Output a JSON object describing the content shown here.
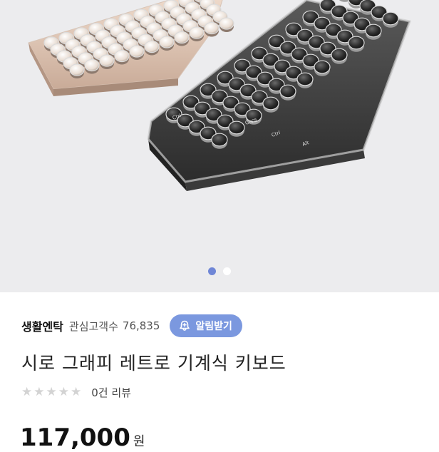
{
  "gallery": {
    "image_alt": "retro typewriter-style mechanical keyboards, pink-gold and black",
    "key_legends": [
      "Alt",
      "Caps",
      "Ctrl",
      "Ctrl"
    ],
    "slide_count": 2,
    "active_slide": 1
  },
  "seller": {
    "name": "생활엔탁",
    "follower_label": "관심고객수",
    "follower_count": "76,835",
    "notify_label": "알림받기",
    "notify_icon": "bell-plus-icon"
  },
  "product": {
    "title": "시로 그래피 레트로 기계식 키보드"
  },
  "rating": {
    "stars_filled": 0,
    "stars_total": 5,
    "review_text": "0건 리뷰"
  },
  "price": {
    "amount": "117,000",
    "unit": "원"
  },
  "colors": {
    "accent": "#7b98df",
    "dot_active": "#6f86d6",
    "hero_bg": "#ececee"
  }
}
